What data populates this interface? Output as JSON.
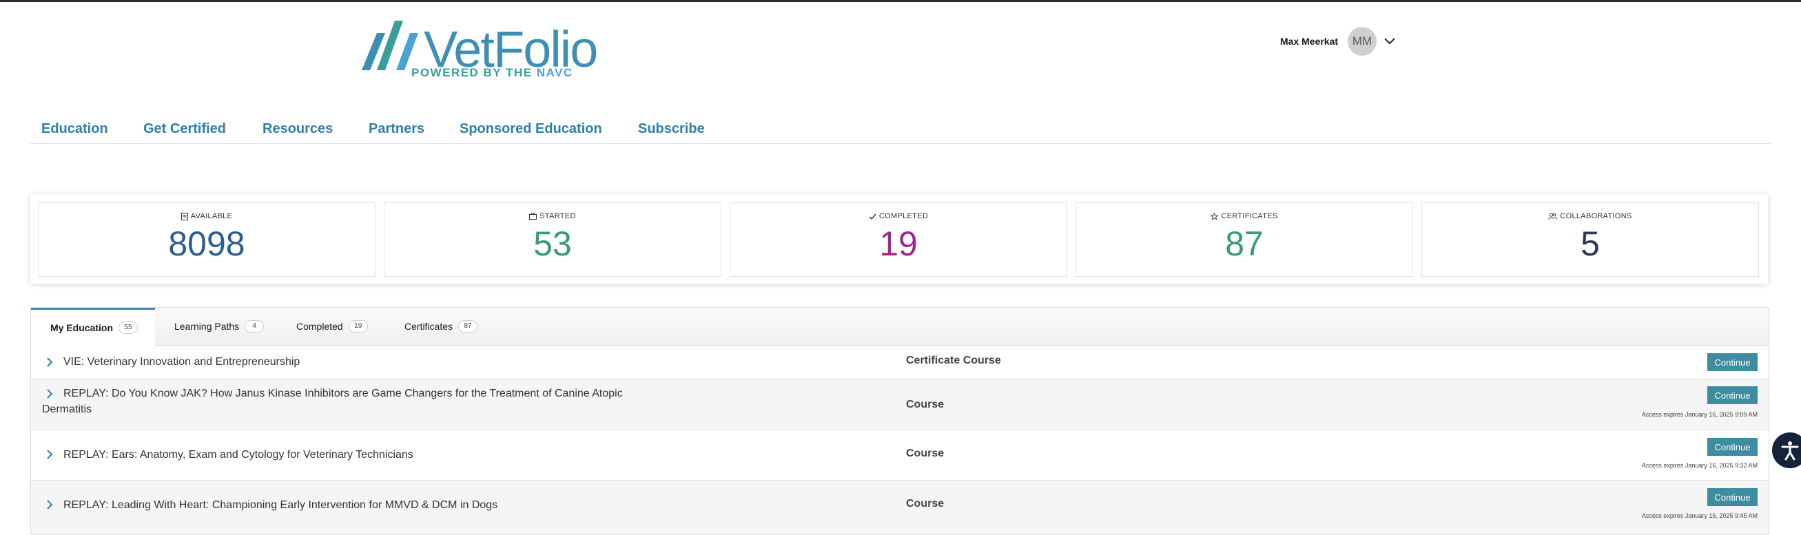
{
  "header": {
    "logo_text": "VetFolio",
    "logo_tagline_prefix": "POWERED BY THE ",
    "logo_tagline_brand": "NAVC",
    "user_name": "Max Meerkat",
    "user_initials": "MM"
  },
  "nav": [
    "Education",
    "Get Certified",
    "Resources",
    "Partners",
    "Sponsored Education",
    "Subscribe"
  ],
  "stats": [
    {
      "label": "AVAILABLE",
      "value": "8098",
      "color": "#2c5f8f",
      "icon": "document-icon"
    },
    {
      "label": "STARTED",
      "value": "53",
      "color": "#3a9a7a",
      "icon": "briefcase-icon"
    },
    {
      "label": "COMPLETED",
      "value": "19",
      "color": "#a0288c",
      "icon": "check-icon"
    },
    {
      "label": "CERTIFICATES",
      "value": "87",
      "color": "#3a9a7a",
      "icon": "star-icon"
    },
    {
      "label": "COLLABORATIONS",
      "value": "5",
      "color": "#2f3b4c",
      "icon": "users-icon"
    }
  ],
  "tabs": [
    {
      "label": "My Education",
      "count": "55"
    },
    {
      "label": "Learning Paths",
      "count": "4"
    },
    {
      "label": "Completed",
      "count": "19"
    },
    {
      "label": "Certificates",
      "count": "87"
    }
  ],
  "courses": [
    {
      "title": "VIE: Veterinary Innovation and Entrepreneurship",
      "type": "Certificate Course",
      "action": "Continue",
      "expires": ""
    },
    {
      "title": "REPLAY: Do You Know JAK? How Janus Kinase Inhibitors are Game Changers for the Treatment of Canine Atopic Dermatitis",
      "type": "Course",
      "action": "Continue",
      "expires": "Access expires January 16, 2025 9:09 AM"
    },
    {
      "title": "REPLAY: Ears: Anatomy, Exam and Cytology for Veterinary Technicians",
      "type": "Course",
      "action": "Continue",
      "expires": "Access expires January 16, 2025 9:32 AM"
    },
    {
      "title": "REPLAY: Leading With Heart: Championing Early Intervention for MMVD & DCM in Dogs",
      "type": "Course",
      "action": "Continue",
      "expires": "Access expires January 16, 2025 9:45 AM"
    }
  ]
}
